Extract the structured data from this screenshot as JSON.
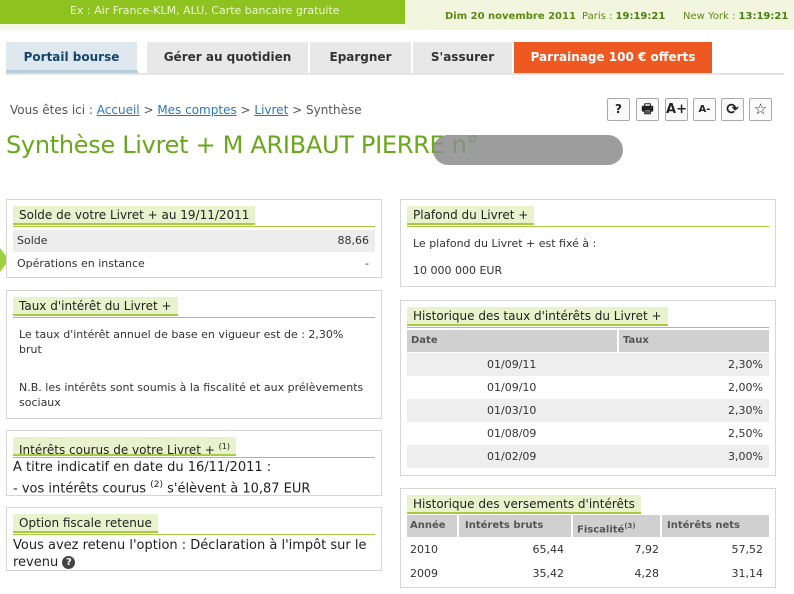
{
  "topbar": {
    "ticker": "Ex : Air France-KLM, ALU, Carte bancaire gratuite",
    "date": "Dim 20 novembre 2011",
    "paris_label": "Paris : ",
    "paris_time": "19:19:21",
    "ny_label": "New York : ",
    "ny_time": "13:19:21"
  },
  "nav": {
    "tabs": [
      {
        "label": "Portail bourse"
      },
      {
        "label": "Gérer au quotidien"
      },
      {
        "label": "Epargner"
      },
      {
        "label": "S'assurer"
      },
      {
        "label": "Parrainage 100 € offerts"
      }
    ]
  },
  "breadcrumb": {
    "prefix": "Vous êtes ici : ",
    "accueil": "Accueil",
    "mes_comptes": "Mes comptes",
    "livret": "Livret",
    "sep": " > ",
    "current": "Synthèse"
  },
  "tools": {
    "help": "?",
    "print": "🖶",
    "font_up": "A+",
    "font_down": "A-",
    "refresh": "⟳",
    "favorite": "☆"
  },
  "title": "Synthèse Livret + M ARIBAUT PIERRE n°",
  "solde": {
    "title": "Solde de votre Livret + au 19/11/2011",
    "rows": [
      {
        "label": "Solde",
        "value": "88,66"
      },
      {
        "label": "Opérations en instance",
        "value": "-"
      }
    ]
  },
  "taux": {
    "title": "Taux d'intérêt du Livret +",
    "text1": "Le taux d'intérêt annuel de base en vigueur est de : 2,30% brut",
    "text2": "N.B. les intérêts sont soumis à la fiscalité et aux prélèvements sociaux"
  },
  "interets": {
    "title": "Intérêts courus de votre Livret + ",
    "title_note": "(1)",
    "line1": "A titre indicatif en date du 16/11/2011 :",
    "line2a": "- vos intérêts courus ",
    "line2_note": "(2)",
    "line2b": " s'élèvent à 10,87 EUR"
  },
  "option": {
    "title": "Option fiscale retenue",
    "text": "Vous avez retenu l'option : Déclaration à l'impôt sur le revenu",
    "help": "?"
  },
  "plafond": {
    "title": "Plafond du Livret +",
    "text": "Le plafond du Livret + est fixé à :",
    "value": "10 000 000 EUR"
  },
  "hist_taux": {
    "title": "Historique des taux d'intérêts du Livret +",
    "col_date": "Date",
    "col_taux": "Taux",
    "rows": [
      {
        "date": "01/09/11",
        "taux": "2,30%"
      },
      {
        "date": "01/09/10",
        "taux": "2,00%"
      },
      {
        "date": "01/03/10",
        "taux": "2,30%"
      },
      {
        "date": "01/08/09",
        "taux": "2,50%"
      },
      {
        "date": "01/02/09",
        "taux": "3,00%"
      }
    ]
  },
  "hist_vers": {
    "title": "Historique des versements d'intérêts",
    "col_annee": "Année",
    "col_bruts": "Intérets bruts",
    "col_fisc": "Fiscalité",
    "col_fisc_note": "(3)",
    "col_nets": "Intérêts nets",
    "rows": [
      {
        "annee": "2010",
        "bruts": "65,44",
        "fisc": "7,92",
        "nets": "57,52"
      },
      {
        "annee": "2009",
        "bruts": "35,42",
        "fisc": "4,28",
        "nets": "31,14"
      }
    ]
  },
  "colors": {
    "brand_green": "#8dc21f",
    "title_green": "#69a81a",
    "orange_tab": "#ee5922",
    "link_blue": "#2a78b8"
  }
}
